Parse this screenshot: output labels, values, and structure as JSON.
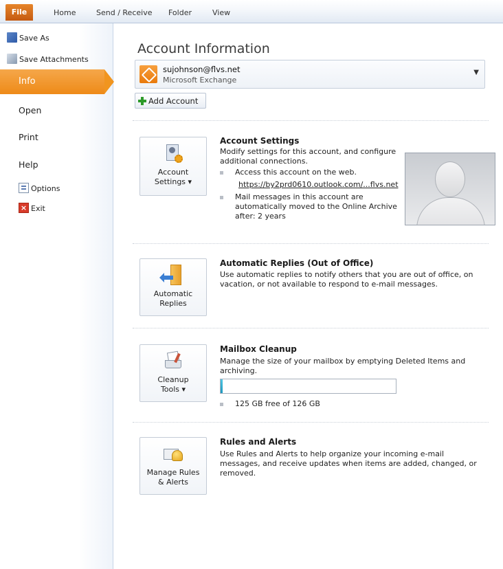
{
  "ribbon": {
    "tabs": [
      "File",
      "Home",
      "Send / Receive",
      "Folder",
      "View"
    ]
  },
  "sidebar": {
    "save_as": "Save As",
    "save_attachments": "Save Attachments",
    "info": "Info",
    "open": "Open",
    "print": "Print",
    "help": "Help",
    "options": "Options",
    "exit": "Exit"
  },
  "account": {
    "heading": "Account Information",
    "email": "sujohnson@flvs.net",
    "type": "Microsoft Exchange",
    "add_account": "Add Account"
  },
  "account_settings": {
    "button_line1": "Account",
    "button_line2": "Settings ▾",
    "title": "Account Settings",
    "desc_line1": "Modify settings for this account, and configure",
    "desc_line2": "additional connections.",
    "bullet1": "Access this account on the web.",
    "link": "https://by2prd0610.outlook.com/...flvs.net",
    "bullet2_line1": "Mail messages in this account are",
    "bullet2_line2": "automatically moved to the Online Archive",
    "bullet2_line3": "after: 2 years"
  },
  "auto_replies": {
    "button_line1": "Automatic",
    "button_line2": "Replies",
    "title": "Automatic Replies (Out of Office)",
    "desc_line1": "Use automatic replies to notify others that you are out of office, on",
    "desc_line2": "vacation, or not available to respond to e-mail messages."
  },
  "mailbox_cleanup": {
    "button_line1": "Cleanup",
    "button_line2": "Tools ▾",
    "title": "Mailbox Cleanup",
    "desc_line1": "Manage the size of your mailbox by emptying Deleted Items and",
    "desc_line2": "archiving.",
    "used_fraction": 0.008,
    "free_text": "125 GB free of 126 GB"
  },
  "rules": {
    "button_line1": "Manage Rules",
    "button_line2": "& Alerts",
    "title": "Rules and Alerts",
    "desc_line1": "Use Rules and Alerts to help organize your incoming e-mail",
    "desc_line2": "messages, and receive updates when items are added, changed, or",
    "desc_line3": "removed."
  },
  "colors": {
    "accent_orange": "#ee8a18",
    "progress_fill": "#1d97bd",
    "ribbon_blue": "#e2e9f3"
  }
}
